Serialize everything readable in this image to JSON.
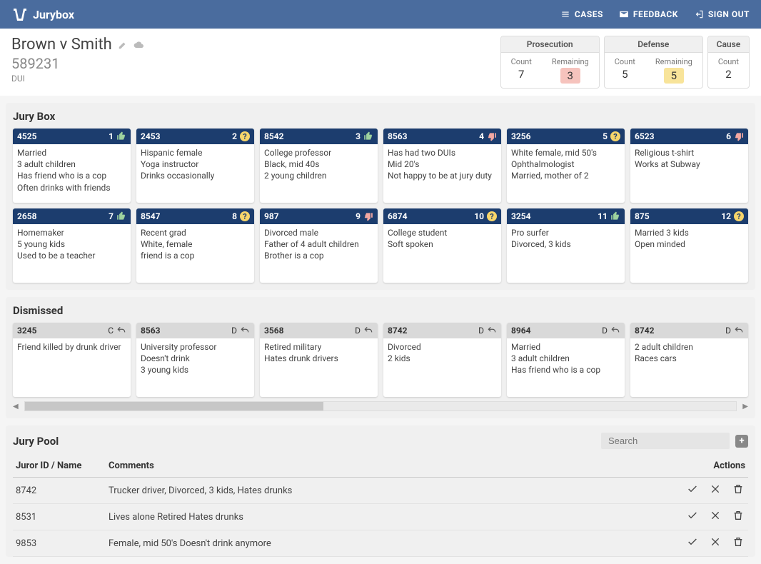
{
  "app_name": "Jurybox",
  "nav": {
    "cases": "CASES",
    "feedback": "FEEDBACK",
    "signout": "SIGN OUT"
  },
  "case": {
    "title": "Brown v Smith",
    "id": "589231",
    "type": "DUI"
  },
  "counts": {
    "prosecution": {
      "title": "Prosecution",
      "count_label": "Count",
      "count": "7",
      "remaining_label": "Remaining",
      "remaining": "3"
    },
    "defense": {
      "title": "Defense",
      "count_label": "Count",
      "count": "5",
      "remaining_label": "Remaining",
      "remaining": "5"
    },
    "cause": {
      "title": "Cause",
      "count_label": "Count",
      "count": "2"
    }
  },
  "jury_box_title": "Jury Box",
  "jurors": [
    {
      "id": "4525",
      "seq": "1",
      "rating": "up",
      "lines": [
        "Married",
        "3 adult children",
        "Has friend who is a cop",
        "Often drinks with friends"
      ]
    },
    {
      "id": "2453",
      "seq": "2",
      "rating": "q",
      "lines": [
        "Hispanic female",
        "Yoga instructor",
        "Drinks occasionally"
      ]
    },
    {
      "id": "8542",
      "seq": "3",
      "rating": "up",
      "lines": [
        "College professor",
        "Black, mid 40s",
        "2 young children"
      ]
    },
    {
      "id": "8563",
      "seq": "4",
      "rating": "down",
      "lines": [
        "Has had two DUIs",
        "Mid 20's",
        "Not happy to be at jury duty"
      ]
    },
    {
      "id": "3256",
      "seq": "5",
      "rating": "q",
      "lines": [
        "White female, mid 50's",
        "Ophthalmologist",
        "Married, mother of 2"
      ]
    },
    {
      "id": "6523",
      "seq": "6",
      "rating": "down",
      "lines": [
        "Religious t-shirt",
        "Works at Subway"
      ]
    },
    {
      "id": "2658",
      "seq": "7",
      "rating": "up",
      "lines": [
        "Homemaker",
        "5 young kids",
        "Used to be a teacher"
      ]
    },
    {
      "id": "8547",
      "seq": "8",
      "rating": "q",
      "lines": [
        "Recent grad",
        "White, female",
        "friend is a cop"
      ]
    },
    {
      "id": "987",
      "seq": "9",
      "rating": "down",
      "lines": [
        "Divorced male",
        "Father of 4 adult children",
        "Brother is a cop"
      ]
    },
    {
      "id": "6874",
      "seq": "10",
      "rating": "q",
      "lines": [
        "College student",
        "Soft spoken"
      ]
    },
    {
      "id": "3254",
      "seq": "11",
      "rating": "up",
      "lines": [
        "Pro surfer",
        "Divorced, 3 kids"
      ]
    },
    {
      "id": "875",
      "seq": "12",
      "rating": "q",
      "lines": [
        "Married 3 kids",
        "Open minded"
      ]
    }
  ],
  "dismissed_title": "Dismissed",
  "dismissed": [
    {
      "id": "3245",
      "code": "C",
      "lines": [
        "Friend killed by drunk driver"
      ]
    },
    {
      "id": "8563",
      "code": "D",
      "lines": [
        "University professor",
        "Doesn't drink",
        "3 young kids"
      ]
    },
    {
      "id": "3568",
      "code": "D",
      "lines": [
        "Retired military",
        "Hates drunk drivers"
      ]
    },
    {
      "id": "8742",
      "code": "D",
      "lines": [
        "Divorced",
        "2 kids"
      ]
    },
    {
      "id": "8964",
      "code": "D",
      "lines": [
        "Married",
        "3 adult children",
        "Has friend who is a cop"
      ]
    },
    {
      "id": "8742",
      "code": "D",
      "lines": [
        "2 adult children",
        "Races cars"
      ]
    }
  ],
  "pool_title": "Jury Pool",
  "pool_search_placeholder": "Search",
  "pool_columns": {
    "id": "Juror ID / Name",
    "comments": "Comments",
    "actions": "Actions"
  },
  "pool": [
    {
      "id": "8742",
      "comments": "Trucker driver, Divorced, 3 kids, Hates drunks"
    },
    {
      "id": "8531",
      "comments": "Lives alone Retired Hates drunks"
    },
    {
      "id": "9853",
      "comments": "Female, mid 50's Doesn't drink anymore"
    }
  ]
}
